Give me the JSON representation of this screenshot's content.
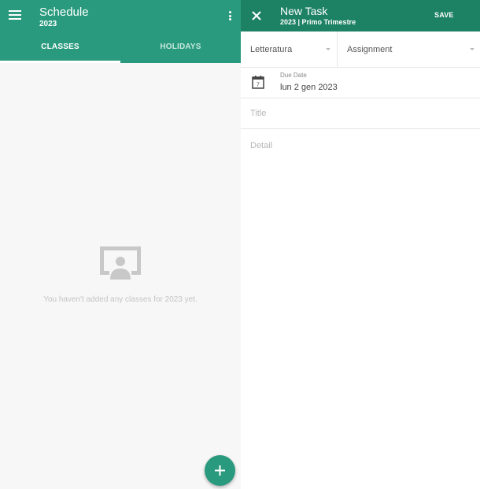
{
  "schedule": {
    "title": "Schedule",
    "subtitle": "2023",
    "tabs": [
      {
        "label": "CLASSES",
        "active": true
      },
      {
        "label": "HOLIDAYS",
        "active": false
      }
    ],
    "empty_message": "You haven't added any classes for 2023 yet.",
    "icons": {
      "menu": "menu-icon",
      "more": "kebab-icon",
      "empty": "classroom-icon",
      "fab": "plus-icon"
    }
  },
  "new_task": {
    "title": "New Task",
    "subtitle": "2023 | Primo Trimestre",
    "save_label": "SAVE",
    "subject_value": "Letteratura",
    "type_value": "Assignment",
    "due_date_label": "Due Date",
    "due_date_value": "lun 2 gen 2023",
    "calendar_day": "7",
    "title_placeholder": "Title",
    "detail_placeholder": "Detail",
    "icons": {
      "close": "close-icon",
      "calendar": "calendar-icon"
    }
  },
  "colors": {
    "primary": "#2a9a7e",
    "primary_dark": "#1d8163",
    "background": "#f7f7f7"
  }
}
